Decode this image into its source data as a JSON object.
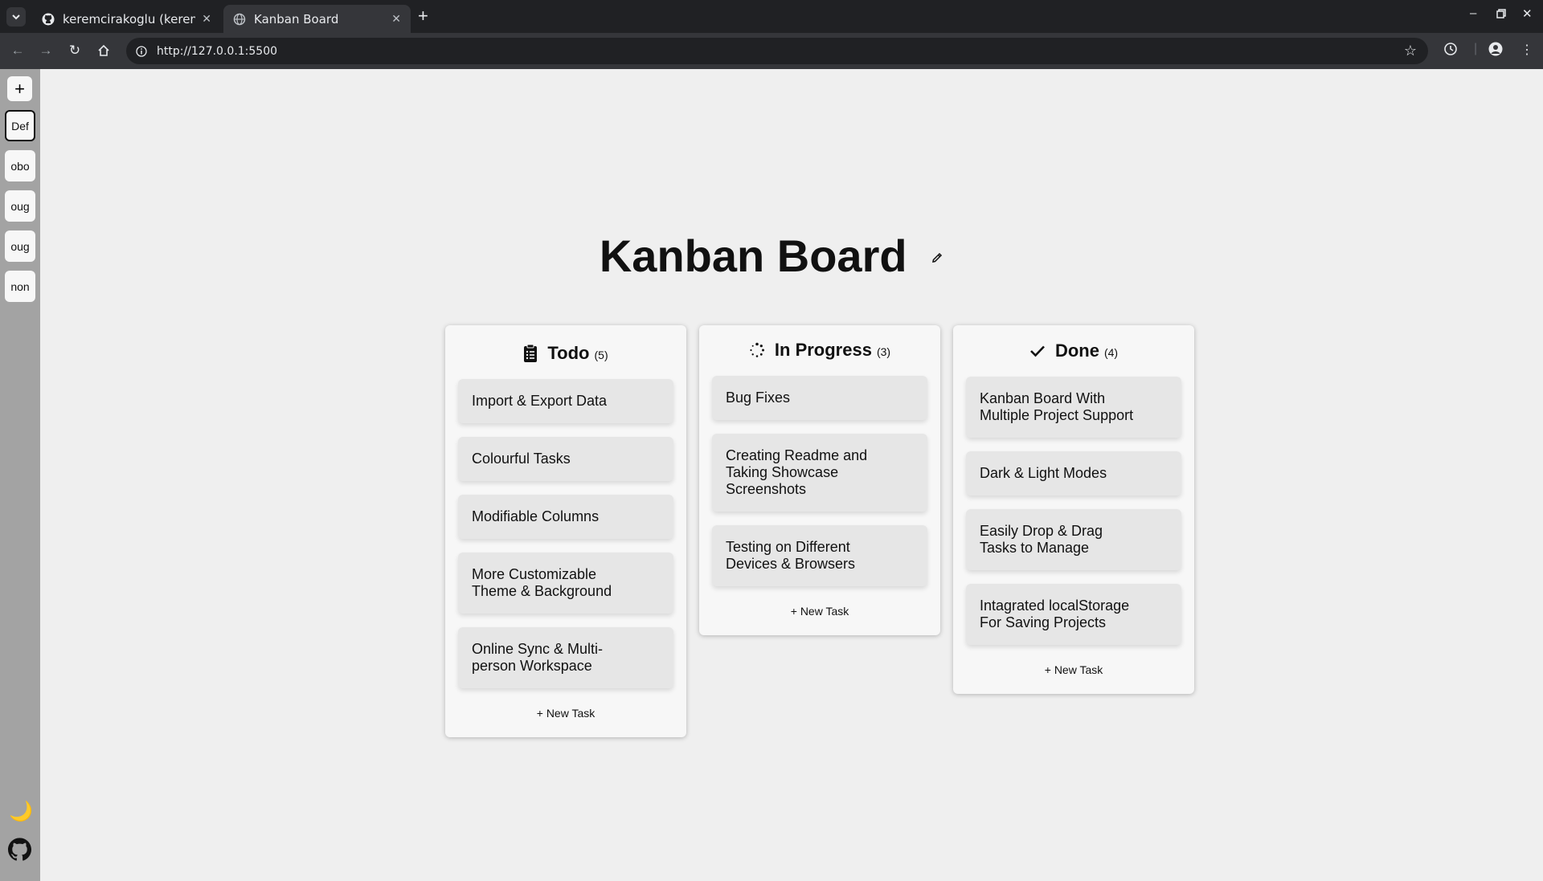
{
  "browser": {
    "tabs": [
      {
        "title": "keremcirakoglu (kerem)",
        "icon": "github-icon"
      },
      {
        "title": "Kanban Board",
        "icon": "globe-icon"
      }
    ],
    "url": "http://127.0.0.1:5500"
  },
  "sidebar": {
    "add_label": "+",
    "projects": [
      "Def",
      "obo",
      "oug",
      "oug",
      "non"
    ],
    "active_index": 0,
    "theme_icon": "moon-icon",
    "github_icon": "github-icon"
  },
  "board": {
    "title": "Kanban Board",
    "columns": [
      {
        "name": "Todo",
        "count": "(5)",
        "icon": "clipboard-icon",
        "tasks": [
          "Import & Export Data",
          "Colourful Tasks",
          "Modifiable Columns",
          "More Customizable Theme & Background",
          "Online Sync & Multi-person Workspace"
        ],
        "new_task": "+ New Task"
      },
      {
        "name": "In Progress",
        "count": "(3)",
        "icon": "spinner-icon",
        "tasks": [
          "Bug Fixes",
          "Creating Readme and Taking Showcase Screenshots",
          "Testing on Different Devices & Browsers"
        ],
        "new_task": "+ New Task"
      },
      {
        "name": "Done",
        "count": "(4)",
        "icon": "check-icon",
        "tasks": [
          "Kanban Board With Multiple Project Support",
          "Dark & Light Modes",
          "Easily Drop & Drag Tasks to Manage",
          "Intagrated localStorage For Saving Projects"
        ],
        "new_task": "+ New Task"
      }
    ]
  }
}
